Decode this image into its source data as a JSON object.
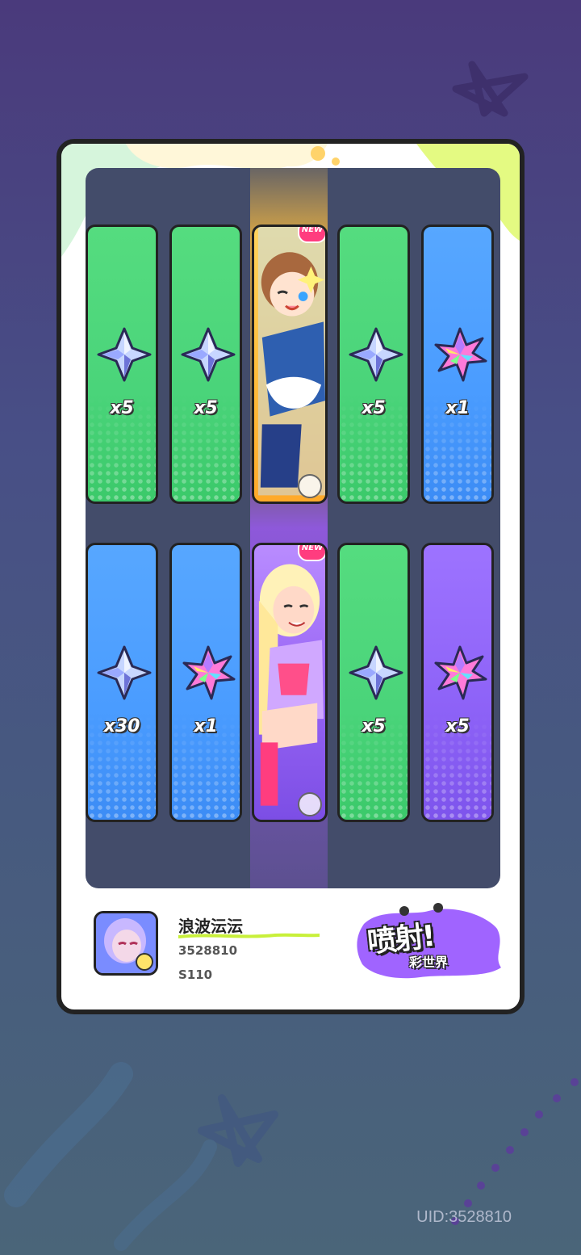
{
  "tiles_row1": [
    {
      "kind": "item",
      "color": "green",
      "icon": "star-crystal-icon",
      "qty": "x5"
    },
    {
      "kind": "item",
      "color": "green",
      "icon": "star-crystal-icon",
      "qty": "x5"
    },
    {
      "kind": "character",
      "color": "char1",
      "new_badge": "NEW",
      "icon": "gun-badge-icon"
    },
    {
      "kind": "item",
      "color": "green",
      "icon": "star-crystal-icon",
      "qty": "x5"
    },
    {
      "kind": "item",
      "color": "blue",
      "icon": "rainbow-leaf-icon",
      "qty": "x1"
    }
  ],
  "tiles_row2": [
    {
      "kind": "item",
      "color": "blue",
      "icon": "star-crystal-icon",
      "qty": "x30"
    },
    {
      "kind": "item",
      "color": "blue",
      "icon": "rainbow-leaf-icon",
      "qty": "x1"
    },
    {
      "kind": "character",
      "color": "char2",
      "new_badge": "NEW",
      "icon": "gun-badge-icon"
    },
    {
      "kind": "item",
      "color": "green",
      "icon": "star-crystal-icon",
      "qty": "x5"
    },
    {
      "kind": "item",
      "color": "purple",
      "icon": "rainbow-leaf-icon",
      "qty": "x5"
    }
  ],
  "player": {
    "nickname": "浪波沄沄",
    "uid": "3528810",
    "server": "S110"
  },
  "logo": {
    "title": "喷射!",
    "subtitle": "彩世界"
  },
  "footer_uid": "UID:3528810",
  "colors": {
    "green_tile": "#4ad47a",
    "blue_tile": "#4a9cff",
    "purple_tile": "#8d62f7",
    "panel": "#434c6a",
    "new_badge": "#ff3d7f"
  }
}
